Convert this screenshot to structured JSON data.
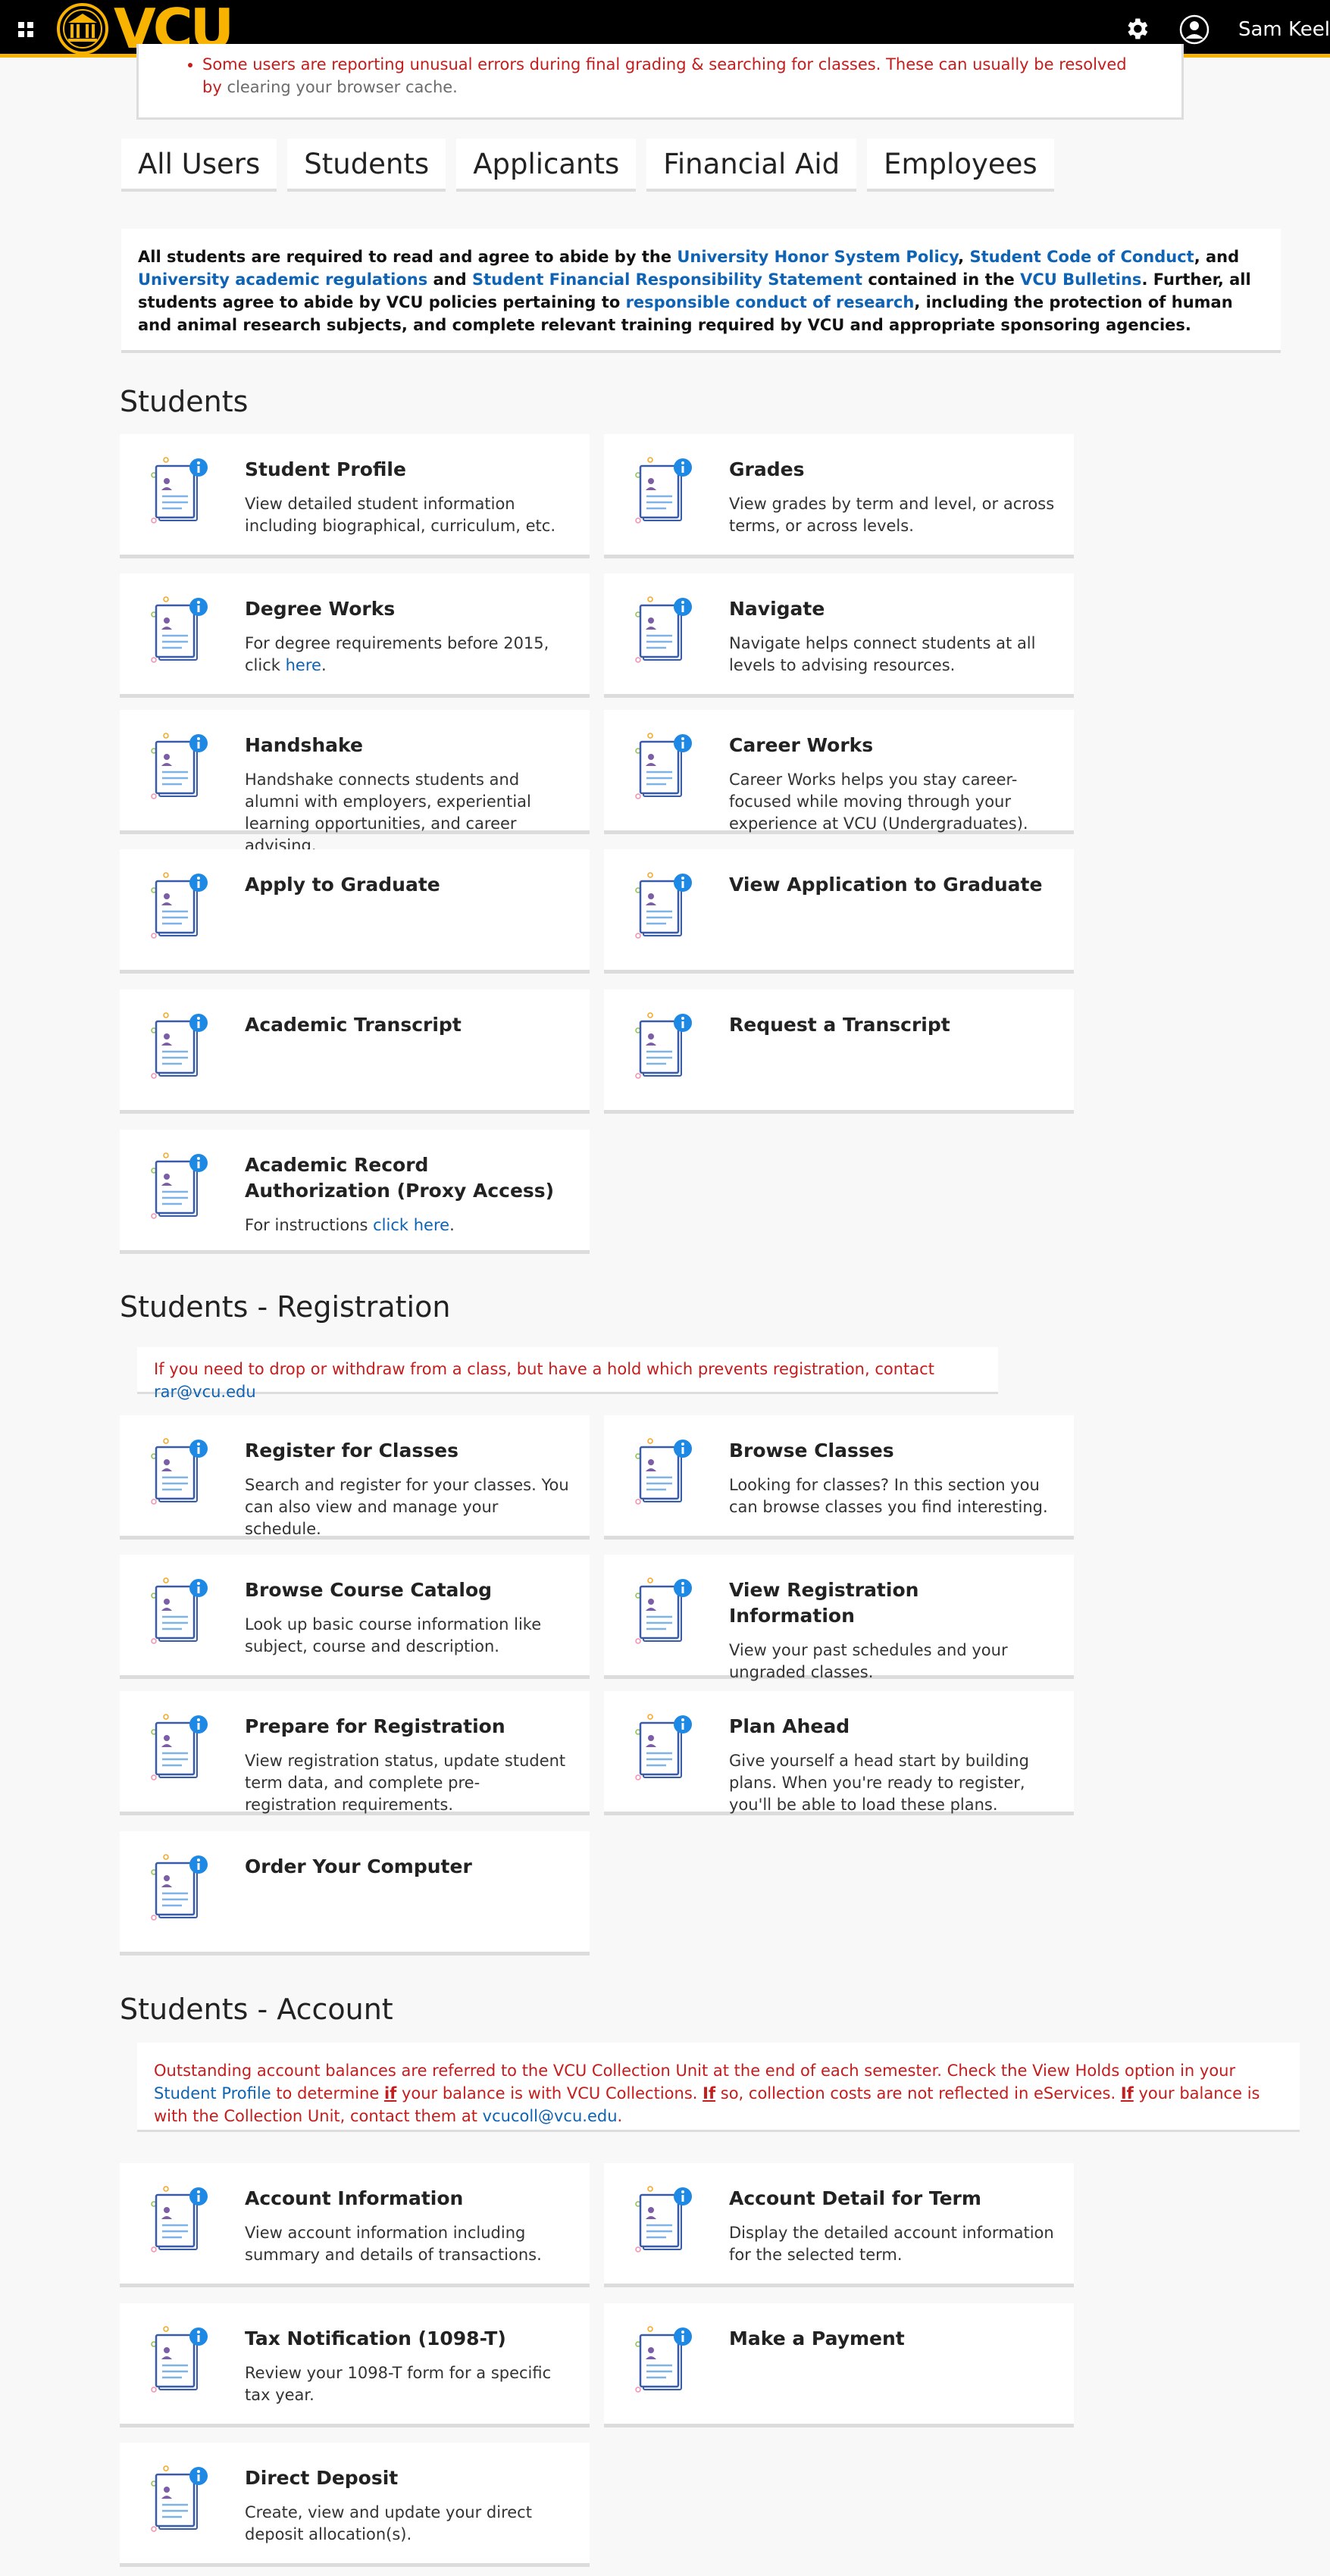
{
  "header": {
    "logo_text": "VCU",
    "user_name": "Sam Keeler"
  },
  "alert": {
    "text": "Some users are reporting unusual errors during final grading & searching for classes. These can usually be resolved by ",
    "link": "clearing your browser cache."
  },
  "tabs": [
    "All Users",
    "Students",
    "Applicants",
    "Financial Aid",
    "Employees"
  ],
  "policy": {
    "t1": "All students are required to read and agree to abide by the ",
    "l1": "University Honor System Policy",
    "t2": ", ",
    "l2": "Student Code of Conduct",
    "t3": ", and ",
    "l3": "University academic regulations",
    "t4": " and ",
    "l4": "Student Financial Responsibility Statement",
    "t5": " contained in the ",
    "l5": "VCU Bulletins",
    "t6": ". Further, all students agree to abide by VCU policies pertaining to ",
    "l6": "responsible conduct of research",
    "t7": ", including the protection of human and animal research subjects, and complete relevant training required by VCU and appropriate sponsoring agencies."
  },
  "sections": {
    "students": "Students",
    "registration": "Students - Registration",
    "account": "Students - Account"
  },
  "registration_notice": {
    "text": "If you need to drop or withdraw from a class, but have a hold which prevents registration, contact ",
    "link": "rar@vcu.edu"
  },
  "account_notice": {
    "t1": "Outstanding account balances are referred to the VCU Collection Unit at the end of each semester. Check the View Holds option in your ",
    "l1": "Student Profile",
    "t2": " to determine ",
    "u1": "if",
    "t3": " your balance is with VCU Collections. ",
    "u2": "If",
    "t4": " so, collection costs are not reflected in eServices. ",
    "u3": "If",
    "t5": " your balance is with the Collection Unit, contact them at ",
    "l2": "vcucoll@vcu.edu",
    "t6": "."
  },
  "cards": [
    {
      "title": "Student Profile",
      "desc": "View detailed student information including biographical, curriculum, etc."
    },
    {
      "title": "Grades",
      "desc": "View grades by term and level, or across terms, or across levels."
    },
    {
      "title": "Degree Works",
      "desc": "For degree requirements before 2015, click ",
      "link": "here",
      "desc_after": "."
    },
    {
      "title": "Navigate",
      "desc": "Navigate helps connect students at all levels to advising resources."
    },
    {
      "title": "Handshake",
      "desc": "Handshake connects students and alumni with employers, experiential learning opportunities, and career advising."
    },
    {
      "title": "Career Works",
      "desc": "Career Works helps you stay career-focused while moving through your experience at VCU (Undergraduates)."
    },
    {
      "title": "Apply to Graduate",
      "desc": ""
    },
    {
      "title": "View Application to Graduate",
      "desc": ""
    },
    {
      "title": "Academic Transcript",
      "desc": ""
    },
    {
      "title": "Request a Transcript",
      "desc": ""
    },
    {
      "title": "Academic Record Authorization (Proxy Access)",
      "desc": "For instructions ",
      "link": "click here",
      "desc_after": "."
    },
    {
      "title": "Register for Classes",
      "desc": "Search and register for your classes. You can also view and manage your schedule."
    },
    {
      "title": "Browse Classes",
      "desc": "Looking for classes? In this section you can browse classes you find interesting."
    },
    {
      "title": "Browse Course Catalog",
      "desc": "Look up basic course information like subject, course and description."
    },
    {
      "title": "View Registration Information",
      "desc": "View your past schedules and your ungraded classes."
    },
    {
      "title": "Prepare for Registration",
      "desc": "View registration status, update student term data, and complete pre-registration requirements."
    },
    {
      "title": "Plan Ahead",
      "desc": "Give yourself a head start by building plans. When you're ready to register, you'll be able to load these plans."
    },
    {
      "title": "Order Your Computer",
      "desc": ""
    },
    {
      "title": "Account Information",
      "desc": "View account information including summary and details of transactions."
    },
    {
      "title": "Account Detail for Term",
      "desc": "Display the detailed account information for the selected term."
    },
    {
      "title": "Tax Notification (1098-T)",
      "desc": "Review your 1098-T form for a specific tax year."
    },
    {
      "title": "Make a Payment",
      "desc": ""
    },
    {
      "title": "Direct Deposit",
      "desc": "Create, view and update your direct deposit allocation(s)."
    }
  ],
  "colors": {
    "brand_gold": "#f8b300",
    "link_blue": "#0f63b4",
    "alert_red": "#c41d1d"
  }
}
